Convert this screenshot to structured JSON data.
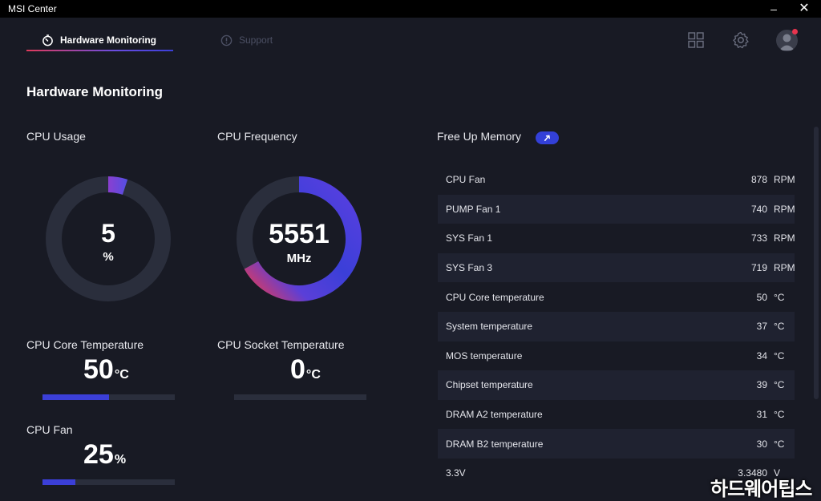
{
  "window": {
    "title": "MSI Center"
  },
  "tabs": [
    {
      "label": "Hardware Monitoring",
      "active": true
    },
    {
      "label": "Support",
      "active": false
    }
  ],
  "page_title": "Hardware Monitoring",
  "cpu_usage": {
    "label": "CPU Usage",
    "value": "5",
    "unit": "%",
    "fraction": 0.05
  },
  "cpu_frequency": {
    "label": "CPU Frequency",
    "value": "5551",
    "unit": "MHz",
    "fraction": 0.67
  },
  "cpu_core_temp": {
    "label": "CPU Core Temperature",
    "value": "50",
    "unit": "°C",
    "fraction": 0.5
  },
  "cpu_socket_temp": {
    "label": "CPU Socket Temperature",
    "value": "0",
    "unit": "°C",
    "fraction": 0.0
  },
  "cpu_fan": {
    "label": "CPU Fan",
    "value": "25",
    "unit": "%",
    "fraction": 0.25
  },
  "memory": {
    "label": "Free Up Memory"
  },
  "sensors": [
    {
      "name": "CPU Fan",
      "value": "878",
      "unit": "RPM"
    },
    {
      "name": "PUMP Fan 1",
      "value": "740",
      "unit": "RPM"
    },
    {
      "name": "SYS Fan 1",
      "value": "733",
      "unit": "RPM"
    },
    {
      "name": "SYS Fan 3",
      "value": "719",
      "unit": "RPM"
    },
    {
      "name": "CPU Core temperature",
      "value": "50",
      "unit": "°C"
    },
    {
      "name": "System temperature",
      "value": "37",
      "unit": "°C"
    },
    {
      "name": "MOS temperature",
      "value": "34",
      "unit": "°C"
    },
    {
      "name": "Chipset temperature",
      "value": "39",
      "unit": "°C"
    },
    {
      "name": "DRAM A2 temperature",
      "value": "31",
      "unit": "°C"
    },
    {
      "name": "DRAM B2 temperature",
      "value": "30",
      "unit": "°C"
    },
    {
      "name": "3.3V",
      "value": "3.3480",
      "unit": "V"
    }
  ],
  "watermark": "하드웨어팁스",
  "colors": {
    "accent": "#3b3fd8",
    "accent_pink": "#e03a5a",
    "background": "#181a24",
    "track": "#2a2e3c"
  }
}
